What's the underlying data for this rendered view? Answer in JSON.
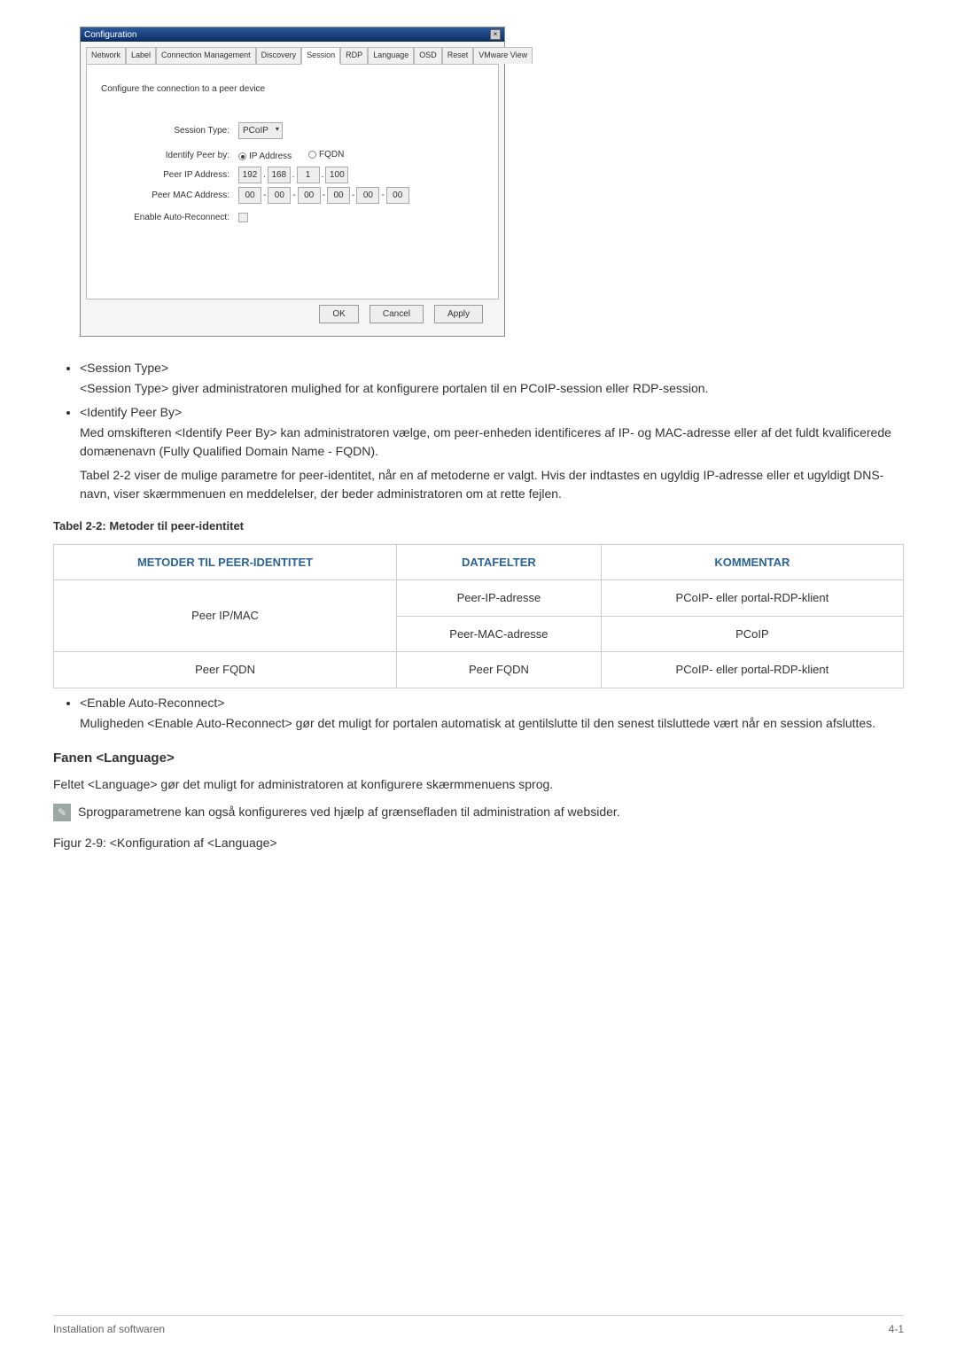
{
  "dialog": {
    "title": "Configuration",
    "tabs": [
      "Network",
      "Label",
      "Connection Management",
      "Discovery",
      "Session",
      "RDP",
      "Language",
      "OSD",
      "Reset",
      "VMware View"
    ],
    "active_tab_index": 4,
    "panel_intro": "Configure the connection to a peer device",
    "labels": {
      "session_type": "Session Type:",
      "identify_peer_by": "Identify Peer by:",
      "peer_ip": "Peer IP Address:",
      "peer_mac": "Peer MAC Address:",
      "enable_auto": "Enable Auto-Reconnect:"
    },
    "session_type_value": "PCoIP",
    "identify_options": {
      "ip": "IP Address",
      "fqdn": "FQDN"
    },
    "peer_ip_octets": [
      "192",
      "168",
      "1",
      "100"
    ],
    "peer_mac_octets": [
      "00",
      "00",
      "00",
      "00",
      "00",
      "00"
    ],
    "buttons": {
      "ok": "OK",
      "cancel": "Cancel",
      "apply": "Apply"
    }
  },
  "body": {
    "bullet1_head": "<Session Type>",
    "bullet1_p1": "<Session Type> giver administratoren mulighed for at konfigurere portalen til en PCoIP-session eller RDP-session.",
    "bullet2_head": "<Identify Peer By>",
    "bullet2_p1": "Med omskifteren <Identify Peer By> kan administratoren vælge, om peer-enheden identificeres af IP- og MAC-adresse eller af det fuldt kvalificerede domænenavn (Fully Qualified Domain Name - FQDN).",
    "bullet2_p2": "Tabel 2-2 viser de mulige parametre for peer-identitet, når en af metoderne er valgt. Hvis der indtastes en ugyldig IP-adresse eller et ugyldigt DNS-navn, viser skærmmenuen en meddelelser, der beder administratoren om at rette fejlen.",
    "table_caption": "Tabel 2-2: Metoder til peer-identitet",
    "th1": "METODER TIL PEER-IDENTITET",
    "th2": "DATAFELTER",
    "th3": "KOMMENTAR",
    "r1c1": "Peer IP/MAC",
    "r1c2": "Peer-IP-adresse",
    "r1c3": "PCoIP- eller portal-RDP-klient",
    "r2c2": "Peer-MAC-adresse",
    "r2c3": "PCoIP",
    "r3c1": "Peer FQDN",
    "r3c2": "Peer FQDN",
    "r3c3": "PCoIP- eller portal-RDP-klient",
    "bullet3_head": "<Enable Auto-Reconnect>",
    "bullet3_p1": "Muligheden <Enable Auto-Reconnect> gør det muligt for portalen automatisk at gentilslutte til den senest tilsluttede vært når en session afsluttes.",
    "section_heading": "Fanen <Language>",
    "section_p": "Feltet <Language> gør det muligt for administratoren at konfigurere skærmmenuens sprog.",
    "note": "Sprogparametrene kan også konfigureres ved hjælp af grænsefladen til administration af websider.",
    "figure_caption": "Figur 2-9: <Konfiguration af <Language>"
  },
  "footer": {
    "left": "Installation af softwaren",
    "right": "4-1"
  },
  "chart_data": {
    "type": "table",
    "title": "Tabel 2-2: Metoder til peer-identitet",
    "columns": [
      "METODER TIL PEER-IDENTITET",
      "DATAFELTER",
      "KOMMENTAR"
    ],
    "rows": [
      [
        "Peer IP/MAC",
        "Peer-IP-adresse",
        "PCoIP- eller portal-RDP-klient"
      ],
      [
        "Peer IP/MAC",
        "Peer-MAC-adresse",
        "PCoIP"
      ],
      [
        "Peer FQDN",
        "Peer FQDN",
        "PCoIP- eller portal-RDP-klient"
      ]
    ]
  }
}
